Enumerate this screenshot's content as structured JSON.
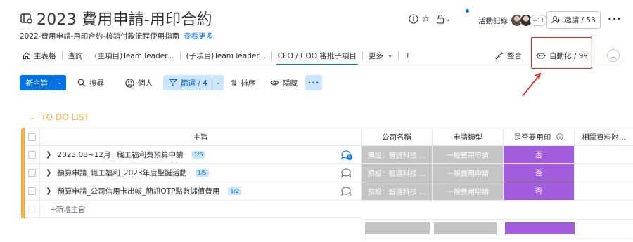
{
  "header": {
    "title": "2023 費用申請-用印合約",
    "subtitle": "2022-費用申請-用印合約-核銷付款流程使用指南",
    "subtitle_link": "查看更多",
    "activity_label": "活動記錄",
    "avatar_extra_count": "+11",
    "invite_label": "邀請 / 53"
  },
  "tabs": [
    {
      "label": "主表格",
      "icon": "home-icon"
    },
    {
      "label": "查詢"
    },
    {
      "label": "(主項目)Team leader..."
    },
    {
      "label": "(子項目)Team leader..."
    },
    {
      "label": "CEO / COO 審批子項目",
      "active": true
    },
    {
      "label": "更多"
    },
    {
      "label": "+"
    }
  ],
  "tab_actions": {
    "integrate_label": "整合",
    "automate_label": "自動化 / 99"
  },
  "toolbar": {
    "new_item_label": "新主旨",
    "search_label": "搜尋",
    "person_label": "個人",
    "filter_label": "篩選 / 4",
    "sort_label": "排序",
    "hide_label": "隱藏"
  },
  "group": {
    "title": "TO DO LIST",
    "color": "#fdab3d"
  },
  "table": {
    "columns": [
      "主旨",
      "公司名稱",
      "申請類型",
      "是否要用印",
      "相關資料附..."
    ],
    "rows": [
      {
        "name": "2023.08~12月_ 職工福利費預算申請",
        "subitems": "1/6",
        "updates": "8",
        "company": "預設：智選科技 ...",
        "type": "一般費用申請",
        "seal": "否"
      },
      {
        "name": "預算申請_職工福利_2023年度聖誕活動",
        "subitems": "1/5",
        "updates": "4",
        "company": "預設：智選科技 ...",
        "type": "一般費用申請",
        "seal": "否"
      },
      {
        "name": "預算申請_公司信用卡出帳_簡訊OTP點數儲值費用",
        "subitems": "1/2",
        "updates": "3",
        "company": "預設：智選科技 ...",
        "type": "一般費用申請",
        "seal": "否"
      }
    ],
    "add_item_label": "+新增主旨"
  },
  "colors": {
    "primary": "#0073ea",
    "status_grey": "#c4c4c4",
    "status_purple": "#a25ddc",
    "highlight_red": "#e8261b"
  }
}
